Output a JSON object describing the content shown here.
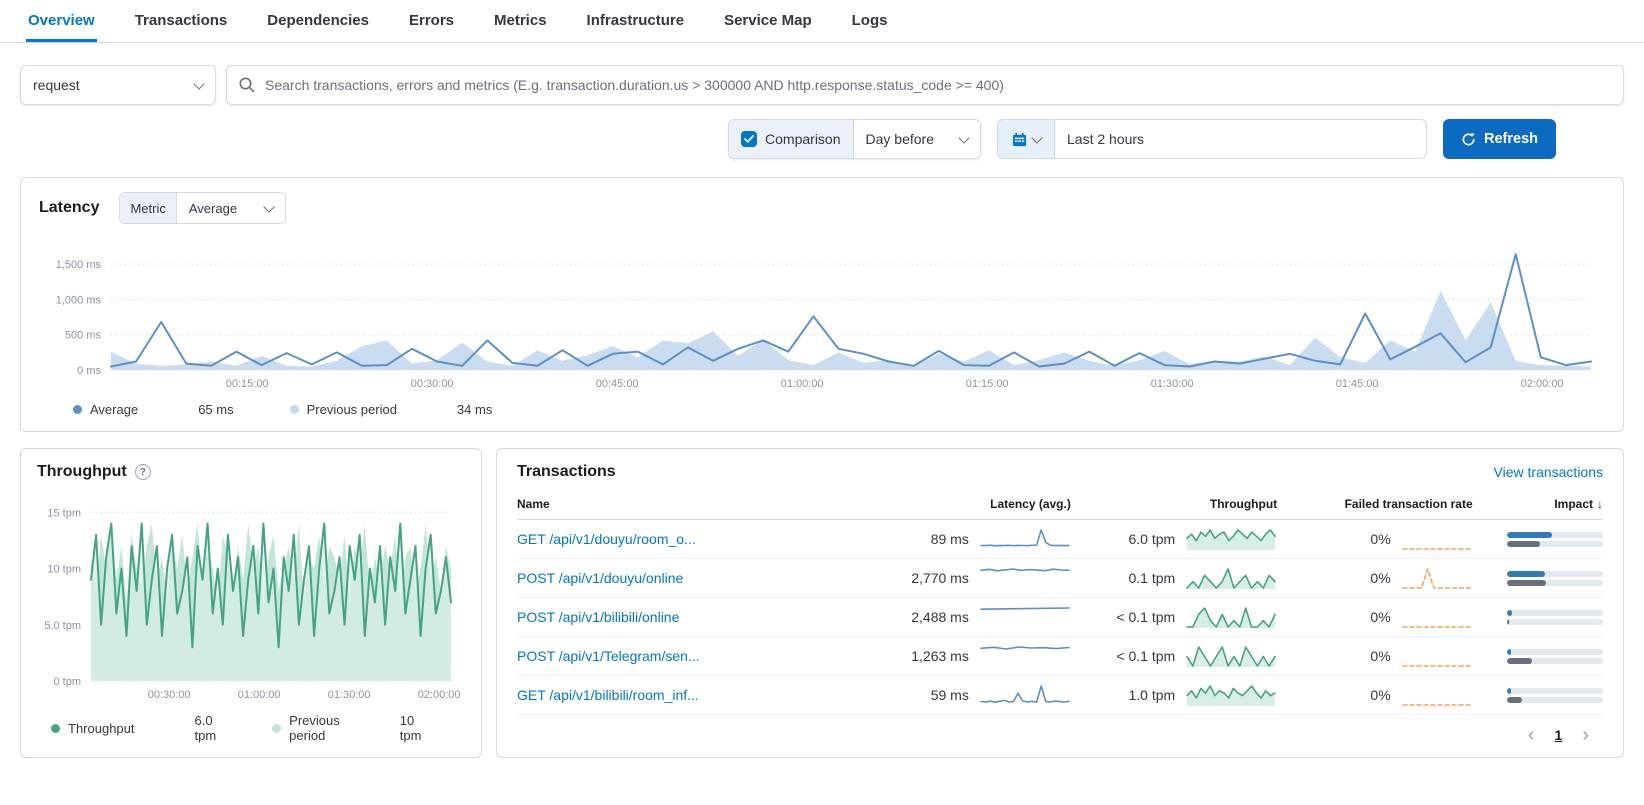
{
  "colors": {
    "accent": "#0077CC",
    "refresh_bg": "#0B6BC2",
    "latency_line": "#5B8FC7",
    "latency_prev_fill": "#C4D9EE",
    "throughput_line": "#45A288",
    "throughput_fill": "#D7EEE6",
    "throughput_prev_fill": "#BCE3D5",
    "failed_line": "#EDA35C",
    "impact_bar": "#2F7DB8",
    "impact_prev": "#69707D",
    "impact_track": "#E2E8F0"
  },
  "tabs": [
    {
      "label": "Overview",
      "active": true
    },
    {
      "label": "Transactions",
      "active": false
    },
    {
      "label": "Dependencies",
      "active": false
    },
    {
      "label": "Errors",
      "active": false
    },
    {
      "label": "Metrics",
      "active": false
    },
    {
      "label": "Infrastructure",
      "active": false
    },
    {
      "label": "Service Map",
      "active": false
    },
    {
      "label": "Logs",
      "active": false
    }
  ],
  "search": {
    "scope_value": "request",
    "placeholder": "Search transactions, errors and metrics (E.g. transaction.duration.us > 300000 AND http.response.status_code >= 400)"
  },
  "controls": {
    "comparison_label": "Comparison",
    "comparison_checked": true,
    "comparison_value": "Day before",
    "time_value": "Last 2 hours",
    "refresh_label": "Refresh"
  },
  "panels": {
    "latency": {
      "title": "Latency",
      "metric_label": "Metric",
      "metric_value": "Average",
      "legend": [
        {
          "label": "Average",
          "value": "65 ms"
        },
        {
          "label": "Previous period",
          "value": "34 ms"
        }
      ]
    },
    "throughput": {
      "title": "Throughput",
      "legend": [
        {
          "label": "Throughput",
          "value": "6.0 tpm"
        },
        {
          "label": "Previous period",
          "value": "10 tpm"
        }
      ]
    },
    "transactions": {
      "title": "Transactions",
      "view_link": "View transactions",
      "columns": [
        "Name",
        "Latency (avg.)",
        "Throughput",
        "Failed transaction rate",
        "Impact"
      ],
      "rows": [
        {
          "name": "GET /api/v1/douyu/room_o...",
          "latency": "89 ms",
          "throughput": "6.0 tpm",
          "failed_rate": "0%",
          "latency_spark": [
            82,
            78,
            88,
            74,
            84,
            79,
            86,
            76,
            83,
            80,
            77,
            85,
            88,
            440,
            150,
            86,
            79,
            83,
            78,
            81
          ],
          "throughput_spark": [
            5,
            7,
            4,
            8,
            6,
            9,
            5,
            7,
            8,
            4,
            6,
            9,
            7,
            5,
            8,
            6,
            4,
            7,
            9,
            6
          ],
          "failed_spark": [
            0,
            0,
            0,
            0,
            0,
            0,
            0,
            0,
            0,
            0,
            0,
            0
          ],
          "impact_current": 47,
          "impact_previous": 34
        },
        {
          "name": "POST /api/v1/douyu/online",
          "latency": "2,770 ms",
          "throughput": "0.1 tpm",
          "failed_rate": "0%",
          "latency_spark": [
            2700,
            2850,
            2620,
            2760,
            2900,
            2680,
            2810,
            2730,
            2640,
            2870,
            2750,
            2700
          ],
          "throughput_spark": [
            0,
            1,
            0,
            2,
            1,
            0,
            1,
            3,
            0,
            1,
            2,
            0,
            1,
            0,
            2,
            1
          ],
          "failed_spark": [
            0,
            0,
            0,
            0,
            1,
            0,
            0,
            0,
            0,
            0,
            0,
            0
          ],
          "impact_current": 40,
          "impact_previous": 41
        },
        {
          "name": "POST /api/v1/bilibili/online",
          "latency": "2,488 ms",
          "throughput": "< 0.1 tpm",
          "failed_rate": "0%",
          "latency_spark": [
            2400,
            2560
          ],
          "throughput_spark": [
            0,
            0,
            2,
            3,
            1,
            0,
            2,
            0,
            1,
            0,
            3,
            0,
            0,
            1,
            0,
            2
          ],
          "failed_spark": [
            0,
            0,
            0,
            0,
            0,
            0,
            0,
            0,
            0,
            0,
            0,
            0
          ],
          "impact_current": 5,
          "impact_previous": 2
        },
        {
          "name": "POST /api/v1/Telegram/sen...",
          "latency": "1,263 ms",
          "throughput": "< 0.1 tpm",
          "failed_rate": "0%",
          "latency_spark": [
            1240,
            1310,
            1190,
            1330,
            1260,
            1280,
            1220,
            1300
          ],
          "throughput_spark": [
            1,
            0,
            2,
            1,
            0,
            1,
            2,
            0,
            1,
            0,
            2,
            1,
            0,
            1,
            0,
            1
          ],
          "failed_spark": [
            0,
            0,
            0,
            0,
            0,
            0,
            0,
            0,
            0,
            0,
            0,
            0
          ],
          "impact_current": 4,
          "impact_previous": 26
        },
        {
          "name": "GET /api/v1/bilibili/room_inf...",
          "latency": "59 ms",
          "throughput": "1.0 tpm",
          "failed_rate": "0%",
          "latency_spark": [
            62,
            55,
            70,
            48,
            66,
            82,
            54,
            60,
            210,
            72,
            56,
            66,
            50,
            340,
            62,
            55,
            70,
            60,
            54,
            64
          ],
          "throughput_spark": [
            4,
            6,
            3,
            7,
            5,
            8,
            4,
            6,
            5,
            3,
            7,
            5,
            4,
            6,
            8,
            5,
            3,
            6,
            4,
            5
          ],
          "failed_spark": [
            0,
            0,
            0,
            0,
            0,
            0,
            0,
            0,
            0,
            0,
            0,
            0
          ],
          "impact_current": 4,
          "impact_previous": 16
        }
      ],
      "pagination": {
        "page": "1"
      }
    }
  },
  "chart_data": [
    {
      "type": "line",
      "title": "Latency",
      "ylabel": "ms",
      "y_ticks": [
        0,
        500,
        1000,
        1500
      ],
      "y_tick_labels": [
        "0 ms",
        "500 ms",
        "1,000 ms",
        "1,500 ms"
      ],
      "y_max": 1700,
      "x_tick_labels": [
        "00:15:00",
        "00:30:00",
        "00:45:00",
        "01:00:00",
        "01:15:00",
        "01:30:00",
        "01:45:00",
        "02:00:00"
      ],
      "x_tick_fractions": [
        0.092,
        0.217,
        0.342,
        0.467,
        0.592,
        0.717,
        0.842,
        0.967
      ],
      "series": [
        {
          "name": "Average",
          "summary_value": "65 ms",
          "values": [
            50,
            120,
            680,
            90,
            60,
            260,
            70,
            240,
            80,
            250,
            60,
            70,
            300,
            120,
            60,
            420,
            100,
            60,
            280,
            60,
            230,
            260,
            80,
            320,
            130,
            300,
            420,
            260,
            760,
            300,
            230,
            120,
            60,
            270,
            70,
            60,
            250,
            50,
            90,
            260,
            60,
            240,
            70,
            50,
            120,
            90,
            160,
            230,
            130,
            80,
            800,
            150,
            330,
            520,
            110,
            320,
            1640,
            180,
            70,
            120
          ]
        },
        {
          "name": "Previous period",
          "summary_value": "34 ms",
          "values": [
            260,
            90,
            60,
            80,
            120,
            60,
            200,
            60,
            50,
            130,
            340,
            420,
            90,
            140,
            390,
            120,
            60,
            280,
            130,
            210,
            340,
            180,
            420,
            380,
            550,
            200,
            430,
            140,
            70,
            250,
            100,
            140,
            60,
            230,
            120,
            280,
            70,
            140,
            250,
            130,
            60,
            140,
            270,
            80,
            130,
            120,
            190,
            70,
            460,
            180,
            100,
            420,
            260,
            1120,
            420,
            960,
            130,
            70,
            60,
            50
          ]
        }
      ]
    },
    {
      "type": "line",
      "title": "Throughput",
      "ylabel": "tpm",
      "y_ticks": [
        0,
        5,
        10,
        15
      ],
      "y_tick_labels": [
        "0 tpm",
        "5.0 tpm",
        "10 tpm",
        "15 tpm"
      ],
      "y_max": 16,
      "x_tick_labels": [
        "00:30:00",
        "01:00:00",
        "01:30:00",
        "02:00:00"
      ],
      "x_tick_fractions": [
        0.217,
        0.467,
        0.717,
        0.967
      ],
      "series": [
        {
          "name": "Throughput",
          "summary_value": "6.0 tpm",
          "values": [
            9,
            13,
            5,
            11,
            14,
            6,
            10,
            4,
            12,
            8,
            14,
            5,
            9,
            12,
            4,
            10,
            13,
            6,
            8,
            11,
            3,
            12,
            9,
            14,
            6,
            10,
            5,
            13,
            8,
            11,
            4,
            9,
            12,
            6,
            14,
            7,
            10,
            3,
            11,
            8,
            13,
            5,
            9,
            12,
            4,
            10,
            14,
            6,
            8,
            11,
            5,
            12,
            9,
            13,
            4,
            10,
            7,
            12,
            5,
            11,
            8,
            14,
            6,
            9,
            12,
            4,
            10,
            13,
            6,
            8,
            11,
            7
          ]
        },
        {
          "name": "Previous period",
          "summary_value": "10 tpm",
          "values": [
            11,
            8,
            13,
            10,
            14,
            9,
            12,
            7,
            13,
            10,
            8,
            12,
            14,
            9,
            11,
            7,
            12,
            10,
            13,
            8,
            11,
            14,
            9,
            12,
            10,
            7,
            13,
            11,
            8,
            12,
            9,
            14,
            10,
            12,
            7,
            11,
            13,
            8,
            10,
            12,
            9,
            14,
            7,
            11,
            10,
            13,
            8,
            12,
            11,
            9,
            13,
            7,
            12,
            10,
            14,
            8,
            11,
            9,
            12,
            10,
            13,
            7,
            11,
            12,
            8,
            10,
            14,
            9,
            11,
            8,
            12,
            10
          ]
        }
      ]
    }
  ]
}
